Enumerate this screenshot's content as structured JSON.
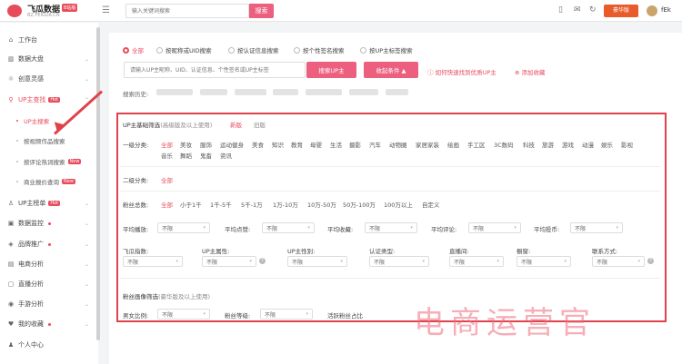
{
  "header": {
    "app_name": "飞瓜数据",
    "badge": "B站版",
    "domain": "BZ.FEIGUA.CN",
    "search_placeholder": "输入关键词搜索",
    "search_button": "搜索",
    "vip_label": "豪华版",
    "username": "fEk",
    "icons": [
      "mobile-icon",
      "message-icon",
      "refresh-icon",
      "bell-icon"
    ]
  },
  "sidebar": {
    "items": [
      {
        "label": "工作台",
        "icon": "home-icon"
      },
      {
        "label": "数据大盘",
        "icon": "chart-icon"
      },
      {
        "label": "创意灵感",
        "icon": "bulb-icon"
      },
      {
        "label": "UP主查找",
        "icon": "search-icon",
        "tag": "Hot"
      },
      {
        "label": "UP主搜索"
      },
      {
        "label": "按视频作品搜索"
      },
      {
        "label": "按评论热词搜索",
        "tag": "New"
      },
      {
        "label": "商业报价查询",
        "tag": "New"
      },
      {
        "label": "UP主榜单",
        "icon": "user-icon",
        "tag": "Hot"
      },
      {
        "label": "数据监控",
        "icon": "monitor-icon"
      },
      {
        "label": "品牌推广",
        "icon": "tag-icon"
      },
      {
        "label": "电商分析",
        "icon": "cart-icon"
      },
      {
        "label": "直播分析",
        "icon": "live-icon"
      },
      {
        "label": "手游分析",
        "icon": "game-icon"
      },
      {
        "label": "我的收藏",
        "icon": "heart-icon"
      },
      {
        "label": "个人中心",
        "icon": "person-icon"
      }
    ]
  },
  "search_modes": [
    "全部",
    "按昵称或UID搜索",
    "按认证信息搜索",
    "按个性签名搜索",
    "按UP主标签搜索"
  ],
  "query": {
    "placeholder": "请输入UP主昵称、UID、认证信息、个性签名或UP主标签",
    "search_button": "搜索UP主",
    "collapse_button": "收起条件 ▲",
    "help_link": "如何快速找到优质UP主",
    "favorite_link": "添加收藏",
    "history_label": "搜索历史:"
  },
  "filters": {
    "basic_title": "UP主基础筛选",
    "basic_note": "(高级版及以上使用)",
    "tab_new": "新版",
    "tab_old": "旧版",
    "cat1_label": "一级分类:",
    "cat1_row1": [
      "全部",
      "美妆",
      "服饰",
      "运动健身",
      "美食",
      "知识",
      "教育",
      "母婴",
      "生活",
      "摄影",
      "汽车",
      "动物圈",
      "家居家装",
      "绘画",
      "手工区",
      "3C数码",
      "科技",
      "旅游",
      "游戏",
      "动漫",
      "娱乐",
      "影视"
    ],
    "cat1_row2": [
      "音乐",
      "舞蹈",
      "鬼畜",
      "资讯"
    ],
    "cat2_label": "二级分类:",
    "cat2_value": "全部",
    "fans_label": "粉丝总数:",
    "fans_options": [
      "全部",
      "小于1千",
      "1千-5千",
      "5千-1万",
      "1万-10万",
      "10万-50万",
      "50万-100万",
      "100万以上",
      "自定义"
    ],
    "row_avg": [
      {
        "label": "平均播放:",
        "value": "不限"
      },
      {
        "label": "平均点赞:",
        "value": "不限"
      },
      {
        "label": "平均收藏:",
        "value": "不限"
      },
      {
        "label": "平均评论:",
        "value": "不限"
      },
      {
        "label": "平均投币:",
        "value": "不限"
      }
    ],
    "row_misc": [
      {
        "label": "飞瓜指数:",
        "value": "不限"
      },
      {
        "label": "UP主属性:",
        "value": "不限"
      },
      {
        "label": "UP主性别:",
        "value": "不限"
      },
      {
        "label": "认证类型:",
        "value": "不限"
      },
      {
        "label": "直播间:",
        "value": "不限"
      },
      {
        "label": "橱窗:",
        "value": "不限"
      },
      {
        "label": "联系方式:",
        "value": "不限"
      }
    ],
    "portrait_title": "粉丝画像筛选",
    "portrait_note": "(豪华版及以上使用)",
    "row_portrait": [
      {
        "label": "男女比例:",
        "value": "不限"
      },
      {
        "label": "粉丝等级:",
        "value": "不限"
      },
      {
        "label": "活跃粉丝占比",
        "value": ""
      }
    ]
  },
  "watermark": "电商运营官",
  "colors": {
    "accent": "#e74c5b",
    "highlight_border": "#e0434b",
    "vip": "#e85b2b"
  }
}
